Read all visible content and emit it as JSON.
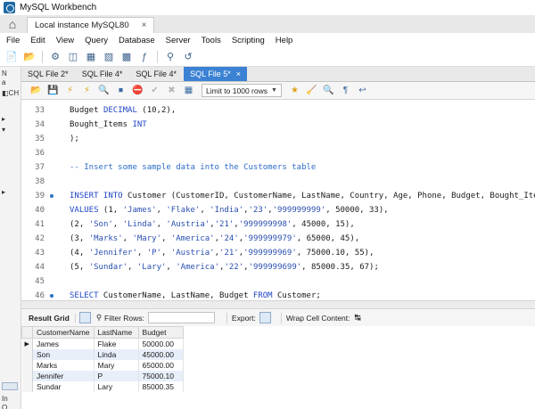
{
  "window": {
    "title": "MySQL Workbench"
  },
  "connection_tab": {
    "label": "Local instance MySQL80",
    "close": "×"
  },
  "menu": [
    "File",
    "Edit",
    "View",
    "Query",
    "Database",
    "Server",
    "Tools",
    "Scripting",
    "Help"
  ],
  "sidebar": {
    "labels": [
      "N",
      "a",
      "◧CH",
      "▸",
      "▾",
      "▸"
    ],
    "bottom": "In",
    "bottom2": "O"
  },
  "file_tabs": [
    {
      "label": "SQL File 2*",
      "active": false
    },
    {
      "label": "SQL File 4*",
      "active": false
    },
    {
      "label": "SQL File 4*",
      "active": false
    },
    {
      "label": "SQL File 5*",
      "active": true,
      "close": "×"
    }
  ],
  "editor_toolbar": {
    "limit_label": "Limit to 1000 rows"
  },
  "code_lines": [
    {
      "ln": "33",
      "dot": false,
      "parts": [
        [
          "",
          "Budget "
        ],
        [
          "kw",
          "DECIMAL"
        ],
        [
          "",
          " (10,2),"
        ]
      ]
    },
    {
      "ln": "34",
      "dot": false,
      "parts": [
        [
          "",
          "Bought_Items "
        ],
        [
          "kw",
          "INT"
        ]
      ]
    },
    {
      "ln": "35",
      "dot": false,
      "parts": [
        [
          "",
          ");"
        ]
      ]
    },
    {
      "ln": "36",
      "dot": false,
      "parts": [
        [
          "",
          ""
        ]
      ]
    },
    {
      "ln": "37",
      "dot": false,
      "parts": [
        [
          "cm",
          "-- Insert some sample data into the Customers table"
        ]
      ]
    },
    {
      "ln": "38",
      "dot": false,
      "parts": [
        [
          "",
          ""
        ]
      ]
    },
    {
      "ln": "39",
      "dot": true,
      "parts": [
        [
          "kw",
          "INSERT INTO"
        ],
        [
          "",
          " Customer (CustomerID, CustomerName, LastName, Country, Age, Phone, Budget, Bought_Items)"
        ]
      ]
    },
    {
      "ln": "40",
      "dot": false,
      "parts": [
        [
          "kw",
          "VALUES"
        ],
        [
          "",
          " (1, "
        ],
        [
          "str",
          "'James'"
        ],
        [
          "",
          ", "
        ],
        [
          "str",
          "'Flake'"
        ],
        [
          "",
          ", "
        ],
        [
          "str",
          "'India'"
        ],
        [
          "",
          ","
        ],
        [
          "str",
          "'23'"
        ],
        [
          "",
          ","
        ],
        [
          "str",
          "'999999999'"
        ],
        [
          "",
          ", 50000, 33),"
        ]
      ]
    },
    {
      "ln": "41",
      "dot": false,
      "parts": [
        [
          "",
          "(2, "
        ],
        [
          "str",
          "'Son'"
        ],
        [
          "",
          ", "
        ],
        [
          "str",
          "'Linda'"
        ],
        [
          "",
          ", "
        ],
        [
          "str",
          "'Austria'"
        ],
        [
          "",
          ","
        ],
        [
          "str",
          "'21'"
        ],
        [
          "",
          ","
        ],
        [
          "str",
          "'999999998'"
        ],
        [
          "",
          ", 45000, 15),"
        ]
      ]
    },
    {
      "ln": "42",
      "dot": false,
      "parts": [
        [
          "",
          "(3, "
        ],
        [
          "str",
          "'Marks'"
        ],
        [
          "",
          ", "
        ],
        [
          "str",
          "'Mary'"
        ],
        [
          "",
          ", "
        ],
        [
          "str",
          "'America'"
        ],
        [
          "",
          ","
        ],
        [
          "str",
          "'24'"
        ],
        [
          "",
          ","
        ],
        [
          "str",
          "'999999979'"
        ],
        [
          "",
          ", 65000, 45),"
        ]
      ]
    },
    {
      "ln": "43",
      "dot": false,
      "parts": [
        [
          "",
          "(4, "
        ],
        [
          "str",
          "'Jennifer'"
        ],
        [
          "",
          ", "
        ],
        [
          "str",
          "'P'"
        ],
        [
          "",
          ", "
        ],
        [
          "str",
          "'Austria'"
        ],
        [
          "",
          ","
        ],
        [
          "str",
          "'21'"
        ],
        [
          "",
          ","
        ],
        [
          "str",
          "'999999969'"
        ],
        [
          "",
          ", 75000.10, 55),"
        ]
      ]
    },
    {
      "ln": "44",
      "dot": false,
      "parts": [
        [
          "",
          "(5, "
        ],
        [
          "str",
          "'Sundar'"
        ],
        [
          "",
          ", "
        ],
        [
          "str",
          "'Lary'"
        ],
        [
          "",
          ", "
        ],
        [
          "str",
          "'America'"
        ],
        [
          "",
          ","
        ],
        [
          "str",
          "'22'"
        ],
        [
          "",
          ","
        ],
        [
          "str",
          "'999999699'"
        ],
        [
          "",
          ", 85000.35, 67);"
        ]
      ]
    },
    {
      "ln": "45",
      "dot": false,
      "parts": [
        [
          "",
          ""
        ]
      ]
    },
    {
      "ln": "46",
      "dot": true,
      "parts": [
        [
          "kw",
          "SELECT"
        ],
        [
          "",
          " CustomerName, LastName, Budget "
        ],
        [
          "kw",
          "FROM"
        ],
        [
          "",
          " Customer;"
        ]
      ]
    }
  ],
  "results": {
    "tab_label": "Result Grid",
    "filter_label": "Filter Rows:",
    "export_label": "Export:",
    "wrap_label": "Wrap Cell Content:",
    "columns": [
      "CustomerName",
      "LastName",
      "Budget"
    ],
    "rows": [
      [
        "James",
        "Flake",
        "50000.00"
      ],
      [
        "Son",
        "Linda",
        "45000.00"
      ],
      [
        "Marks",
        "Mary",
        "65000.00"
      ],
      [
        "Jennifer",
        "P",
        "75000.10"
      ],
      [
        "Sundar",
        "Lary",
        "85000.35"
      ]
    ],
    "current_row_marker": "▶"
  }
}
